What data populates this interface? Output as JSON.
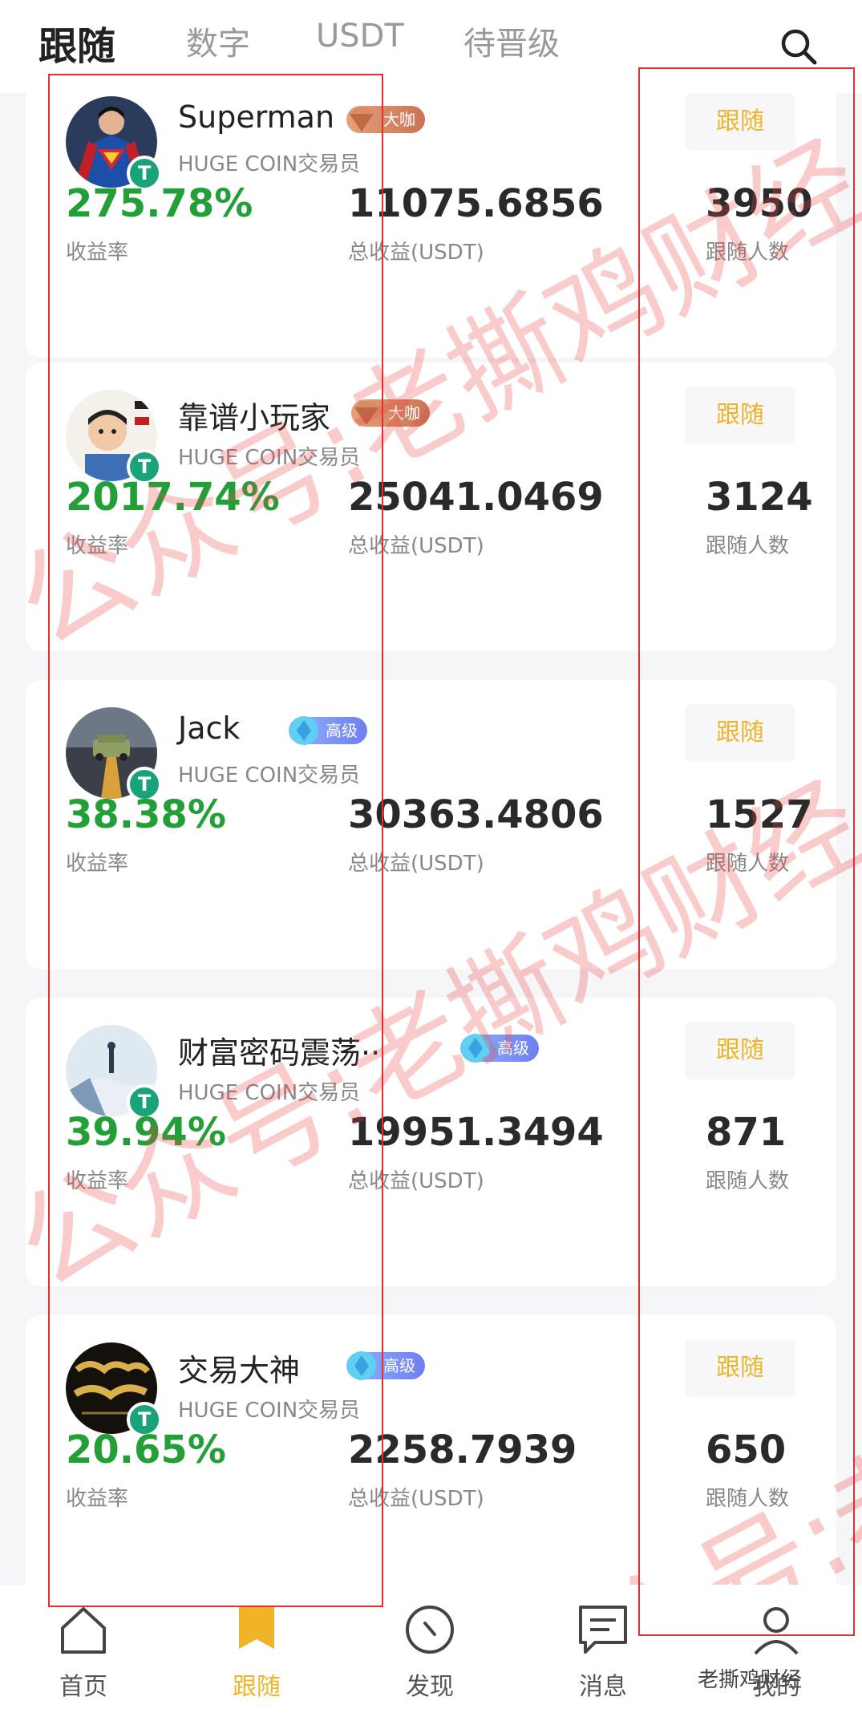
{
  "tabs": [
    {
      "label": "跟随",
      "active": true
    },
    {
      "label": "数字",
      "active": false
    },
    {
      "label": "USDT",
      "active": false
    },
    {
      "label": "待晋级",
      "active": false
    }
  ],
  "search": {
    "icon": "search-icon"
  },
  "traders": [
    {
      "name": "Superman",
      "level": "大咖",
      "role": "HUGE COIN交易员",
      "rate": "275.78%",
      "rate_label": "收益率",
      "total": "11075.6856",
      "total_label": "总收益(USDT)",
      "followers": "3950",
      "followers_label": "跟随人数",
      "follow_label": "跟随"
    },
    {
      "name": "靠谱小玩家",
      "level": "大咖",
      "role": "HUGE COIN交易员",
      "rate": "2017.74%",
      "rate_label": "收益率",
      "total": "25041.0469",
      "total_label": "总收益(USDT)",
      "followers": "3124",
      "followers_label": "跟随人数",
      "follow_label": "跟随"
    },
    {
      "name": "Jack",
      "level": "高级",
      "role": "HUGE COIN交易员",
      "rate": "38.38%",
      "rate_label": "收益率",
      "total": "30363.4806",
      "total_label": "总收益(USDT)",
      "followers": "1527",
      "followers_label": "跟随人数",
      "follow_label": "跟随"
    },
    {
      "name": "财富密码震荡··",
      "level": "高级",
      "role": "HUGE COIN交易员",
      "rate": "39.94%",
      "rate_label": "收益率",
      "total": "19951.3494",
      "total_label": "总收益(USDT)",
      "followers": "871",
      "followers_label": "跟随人数",
      "follow_label": "跟随"
    },
    {
      "name": "交易大神",
      "level": "高级",
      "role": "HUGE COIN交易员",
      "rate": "20.65%",
      "rate_label": "收益率",
      "total": "2258.7939",
      "total_label": "总收益(USDT)",
      "followers": "650",
      "followers_label": "跟随人数",
      "follow_label": "跟随"
    }
  ],
  "badge_symbol": "T",
  "watermark": "公众号:老撕鸡财经",
  "bottom_nav": [
    {
      "label": "首页",
      "icon": "home-icon",
      "active": false
    },
    {
      "label": "跟随",
      "icon": "flag-icon",
      "active": true
    },
    {
      "label": "发现",
      "icon": "compass-icon",
      "active": false
    },
    {
      "label": "消息",
      "icon": "message-icon",
      "active": false
    },
    {
      "label": "我的",
      "icon": "profile-icon",
      "active": false
    }
  ],
  "source_mark": "老撕鸡财经",
  "colors": {
    "positive": "#22a037",
    "accent": "#f0b429",
    "annotation": "#e03030",
    "badge": "#1aa37a"
  }
}
